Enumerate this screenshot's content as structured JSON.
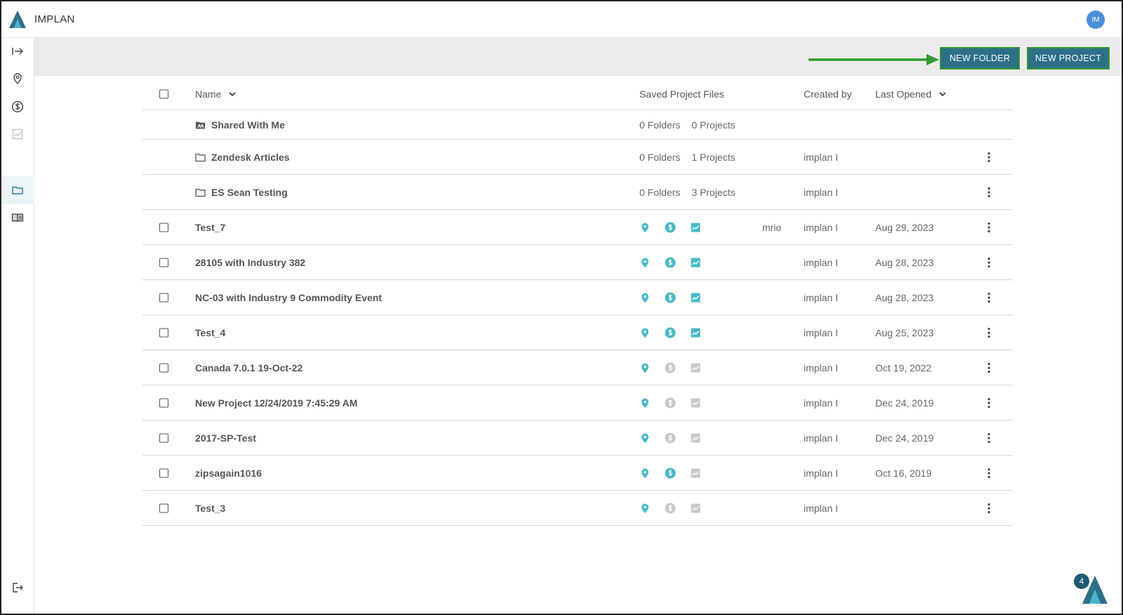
{
  "app": {
    "brand": "IMPLAN",
    "avatar_initials": "IM"
  },
  "toolbar": {
    "new_folder": "NEW FOLDER",
    "new_project": "NEW PROJECT"
  },
  "columns": {
    "name": "Name",
    "saved_files": "Saved Project Files",
    "created_by": "Created by",
    "last_opened": "Last Opened"
  },
  "folders": [
    {
      "name": "Shared With Me",
      "icon": "shared-folder-icon",
      "folders": "0 Folders",
      "projects": "0 Projects",
      "creator": ""
    },
    {
      "name": "Zendesk Articles",
      "icon": "folder-icon",
      "folders": "0 Folders",
      "projects": "1 Projects",
      "creator": "implan I"
    },
    {
      "name": "ES Sean Testing",
      "icon": "folder-icon",
      "folders": "0 Folders",
      "projects": "3 Projects",
      "creator": "implan I"
    }
  ],
  "projects": [
    {
      "name": "Test_7",
      "region": true,
      "impacts": true,
      "results": true,
      "tag": "mrio",
      "creator": "implan I",
      "opened": "Aug 29, 2023"
    },
    {
      "name": "28105 with Industry 382",
      "region": true,
      "impacts": true,
      "results": true,
      "tag": "",
      "creator": "implan I",
      "opened": "Aug 28, 2023"
    },
    {
      "name": "NC-03 with Industry 9 Commodity Event",
      "region": true,
      "impacts": true,
      "results": true,
      "tag": "",
      "creator": "implan I",
      "opened": "Aug 28, 2023"
    },
    {
      "name": "Test_4",
      "region": true,
      "impacts": true,
      "results": true,
      "tag": "",
      "creator": "implan I",
      "opened": "Aug 25, 2023"
    },
    {
      "name": "Canada 7.0.1 19-Oct-22",
      "region": true,
      "impacts": false,
      "results": false,
      "tag": "",
      "creator": "implan I",
      "opened": "Oct 19, 2022"
    },
    {
      "name": "New Project 12/24/2019 7:45:29 AM",
      "region": true,
      "impacts": false,
      "results": false,
      "tag": "",
      "creator": "implan I",
      "opened": "Dec 24, 2019"
    },
    {
      "name": "2017-SP-Test",
      "region": true,
      "impacts": false,
      "results": false,
      "tag": "",
      "creator": "implan I",
      "opened": "Dec 24, 2019"
    },
    {
      "name": "zipsagain1016",
      "region": true,
      "impacts": true,
      "results": false,
      "tag": "",
      "creator": "implan I",
      "opened": "Oct 16, 2019"
    },
    {
      "name": "Test_3",
      "region": true,
      "impacts": false,
      "results": false,
      "tag": "",
      "creator": "implan I",
      "opened": ""
    }
  ],
  "help": {
    "badge_count": "4"
  },
  "colors": {
    "accent": "#2e6f88",
    "teal": "#45b8c9",
    "muted": "#c8c8c8",
    "annotation": "#2f9a2f"
  }
}
